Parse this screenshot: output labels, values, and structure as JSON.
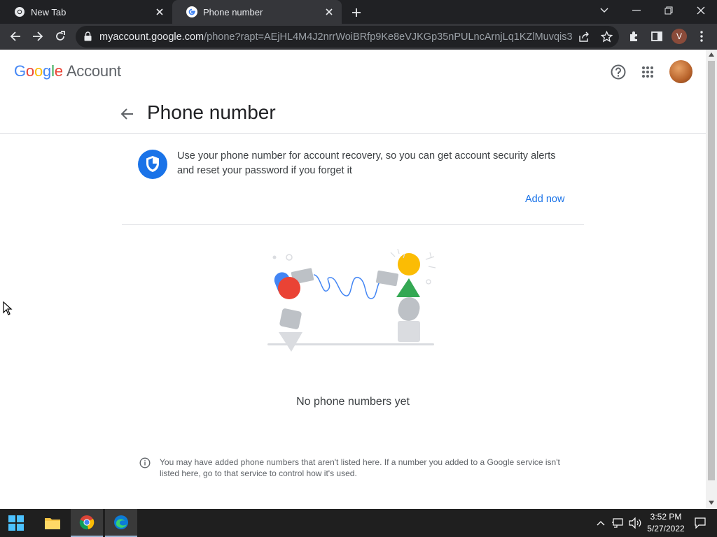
{
  "browser": {
    "tabs": [
      {
        "title": "New Tab",
        "active": false
      },
      {
        "title": "Phone number",
        "active": true
      }
    ],
    "url": {
      "host": "myaccount.google.com",
      "path": "/phone?rapt=AEjHL4M4J2nrrWoiBRfp9Ke8eVJKGp35nPULncArnjLq1KZlMuvqis34hP..."
    },
    "profile_initial": "V"
  },
  "header": {
    "logo_word": "Google",
    "logo_product": "Account"
  },
  "page": {
    "title": "Phone number",
    "recovery_message": "Use your phone number for account recovery, so you can get account security alerts and reset your password if you forget it",
    "add_now": "Add now",
    "empty_state": "No phone numbers yet",
    "footer_note": "You may have added phone numbers that aren't listed here. If a number you added to a Google service isn't listed here, go to that service to control how it's used."
  },
  "taskbar": {
    "time": "3:52 PM",
    "date": "5/27/2022"
  },
  "colors": {
    "google_blue": "#4285f4",
    "google_red": "#ea4335",
    "google_yellow": "#fbbc04",
    "google_green": "#34a853",
    "link": "#1a73e8"
  }
}
